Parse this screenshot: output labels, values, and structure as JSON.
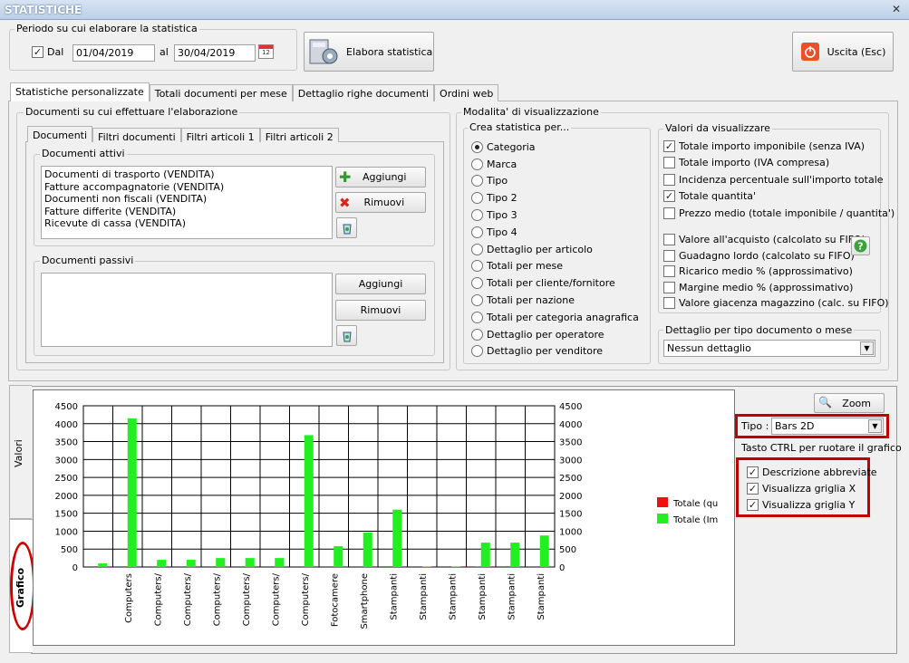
{
  "window": {
    "title": "STATISTICHE",
    "close": "✕"
  },
  "period": {
    "legend": "Periodo su cui elaborare la statistica",
    "dal_label": "Dal",
    "dal_checked": true,
    "from": "01/04/2019",
    "al_label": "al",
    "to": "30/04/2019"
  },
  "toolbar": {
    "elabora": "Elabora statistica",
    "uscita": "Uscita (Esc)"
  },
  "main_tabs": [
    "Statistiche personalizzate",
    "Totali documenti per mese",
    "Dettaglio righe documenti",
    "Ordini web"
  ],
  "docs": {
    "legend": "Documenti su cui effettuare l'elaborazione",
    "tabs": [
      "Documenti",
      "Filtri documenti",
      "Filtri articoli 1",
      "Filtri articoli 2"
    ],
    "attivi": {
      "legend": "Documenti attivi",
      "items": [
        "Documenti di trasporto (VENDITA)",
        "Fatture accompagnatorie (VENDITA)",
        "Documenti non fiscali (VENDITA)",
        "Fatture differite (VENDITA)",
        "Ricevute di cassa (VENDITA)"
      ]
    },
    "passivi": {
      "legend": "Documenti passivi",
      "items": []
    },
    "aggiungi": "Aggiungi",
    "rimuovi": "Rimuovi"
  },
  "modalita": {
    "legend": "Modalita' di visualizzazione",
    "crea": {
      "legend": "Crea statistica per...",
      "options": [
        "Categoria",
        "Marca",
        "Tipo",
        "Tipo 2",
        "Tipo 3",
        "Tipo 4",
        "Dettaglio per articolo",
        "Totali per mese",
        "Totali per cliente/fornitore",
        "Totali per nazione",
        "Totali per categoria anagrafica",
        "Dettaglio per operatore",
        "Dettaglio per venditore"
      ],
      "selected": 0
    },
    "valori": {
      "legend": "Valori da visualizzare",
      "items1": [
        {
          "label": "Totale importo imponibile (senza IVA)",
          "checked": true
        },
        {
          "label": "Totale importo (IVA compresa)",
          "checked": false
        },
        {
          "label": "Incidenza percentuale sull'importo totale",
          "checked": false
        },
        {
          "label": "Totale quantita'",
          "checked": true
        },
        {
          "label": "Prezzo medio (totale imponibile / quantita')",
          "checked": false
        }
      ],
      "items2": [
        {
          "label": "Valore all'acquisto (calcolato su FIFO)",
          "checked": false
        },
        {
          "label": "Guadagno lordo (calcolato su FIFO)",
          "checked": false
        },
        {
          "label": "Ricarico medio % (approssimativo)",
          "checked": false
        },
        {
          "label": "Margine medio % (approssimativo)",
          "checked": false
        },
        {
          "label": "Valore giacenza magazzino (calc. su FIFO)",
          "checked": false
        }
      ]
    },
    "dettaglio": {
      "legend": "Dettaglio per tipo documento o mese",
      "value": "Nessun dettaglio"
    }
  },
  "side_tabs": {
    "valori": "Valori",
    "grafico": "Grafico"
  },
  "chart_controls": {
    "zoom": "Zoom",
    "tipo_label": "Tipo :",
    "tipo_value": "Bars 2D",
    "ctrl_hint": "Tasto CTRL per ruotare il grafico",
    "checks": [
      {
        "label": "Descrizione abbreviate",
        "checked": true
      },
      {
        "label": "Visualizza griglia X",
        "checked": true
      },
      {
        "label": "Visualizza griglia Y",
        "checked": true
      }
    ]
  },
  "colors": {
    "red": "#ee1111",
    "green": "#22ee22",
    "annotation": "#cc0000"
  },
  "chart_data": {
    "type": "bar",
    "categories": [
      "",
      "Computers",
      "Computers/",
      "Computers/",
      "Computers/",
      "Computers/",
      "Computers/",
      "Computers/",
      "Fotocamere",
      "Smartphone",
      "Stampanti",
      "Stampanti",
      "Stampanti",
      "Stampanti",
      "Stampanti",
      "Stampanti"
    ],
    "series": [
      {
        "name": "Totale (qu",
        "color": "#ee1111",
        "values": [
          0,
          0,
          0,
          0,
          0,
          0,
          0,
          0,
          0,
          0,
          20,
          0,
          0,
          15,
          20,
          0
        ]
      },
      {
        "name": "Totale (Im",
        "color": "#22ee22",
        "values": [
          100,
          4150,
          200,
          200,
          250,
          250,
          250,
          3680,
          580,
          960,
          1600,
          10,
          10,
          680,
          680,
          880
        ]
      }
    ],
    "ylim": [
      0,
      4500
    ],
    "yticks": [
      0,
      500,
      1000,
      1500,
      2000,
      2500,
      3000,
      3500,
      4000,
      4500
    ],
    "grid_x": true,
    "grid_y": true,
    "legend": "right"
  }
}
